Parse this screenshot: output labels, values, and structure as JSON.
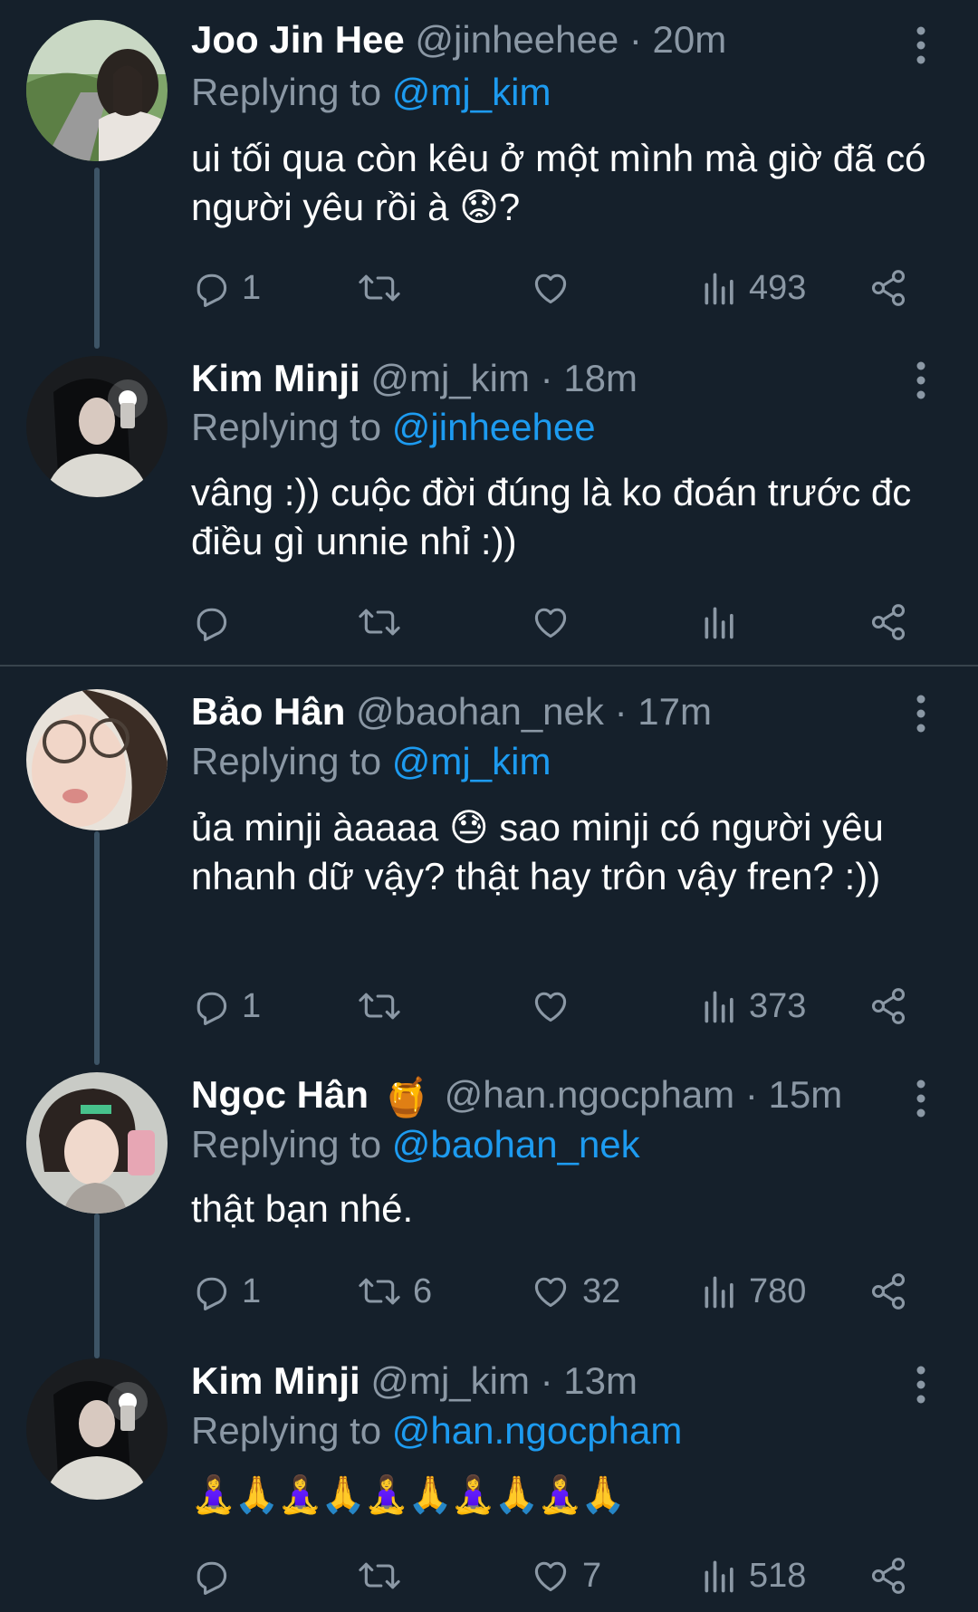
{
  "tweets": [
    {
      "name": "Joo Jin Hee",
      "handle": "@jinheehee",
      "time": "· 20m",
      "replying_prefix": "Replying to",
      "replying_to": "@mj_kim",
      "text": "ui tối qua còn kêu ở một mình mà giờ đã có người yêu rồi à 😟?",
      "replies": "1",
      "retweets": "",
      "likes": "",
      "views": "493",
      "avatar_icon": "avatar-photo"
    },
    {
      "name": "Kim Minji",
      "handle": "@mj_kim",
      "time": "· 18m",
      "replying_prefix": "Replying to",
      "replying_to": "@jinheehee",
      "text": "vâng :)) cuộc đời đúng là ko đoán trước đc điều gì unnie nhỉ :))",
      "replies": "",
      "retweets": "",
      "likes": "",
      "views": "",
      "avatar_icon": "avatar-photo"
    },
    {
      "name": "Bảo Hân",
      "handle": "@baohan_nek",
      "time": "· 17m",
      "replying_prefix": "Replying to",
      "replying_to": "@mj_kim",
      "text": "ủa minji àaaaa 😓 sao minji có người yêu nhanh dữ vậy? thật hay trôn vậy fren? :))",
      "replies": "1",
      "retweets": "",
      "likes": "",
      "views": "373",
      "avatar_icon": "avatar-photo"
    },
    {
      "name": "Ngọc Hân",
      "name_emoji": "🍯",
      "handle": "@han.ngocpham",
      "time": "· 15m",
      "replying_prefix": "Replying to",
      "replying_to": "@baohan_nek",
      "text": "thật bạn nhé.",
      "replies": "1",
      "retweets": "6",
      "likes": "32",
      "views": "780",
      "avatar_icon": "avatar-photo"
    },
    {
      "name": "Kim Minji",
      "handle": "@mj_kim",
      "time": "· 13m",
      "replying_prefix": "Replying to",
      "replying_to": "@han.ngocpham",
      "text": "🧘‍♀️🙏🧘‍♀️🙏🧘‍♀️🙏🧘‍♀️🙏🧘‍♀️🙏",
      "replies": "",
      "retweets": "",
      "likes": "7",
      "views": "518",
      "avatar_icon": "avatar-photo"
    }
  ],
  "icons": {
    "reply": "reply-icon",
    "retweet": "retweet-icon",
    "like": "heart-icon",
    "views": "views-icon",
    "share": "share-icon",
    "more": "more-icon"
  },
  "colors": {
    "background": "#15202b",
    "secondary_text": "#8b98a5",
    "mention": "#1d9bf0",
    "thread_line": "#3d5466"
  }
}
